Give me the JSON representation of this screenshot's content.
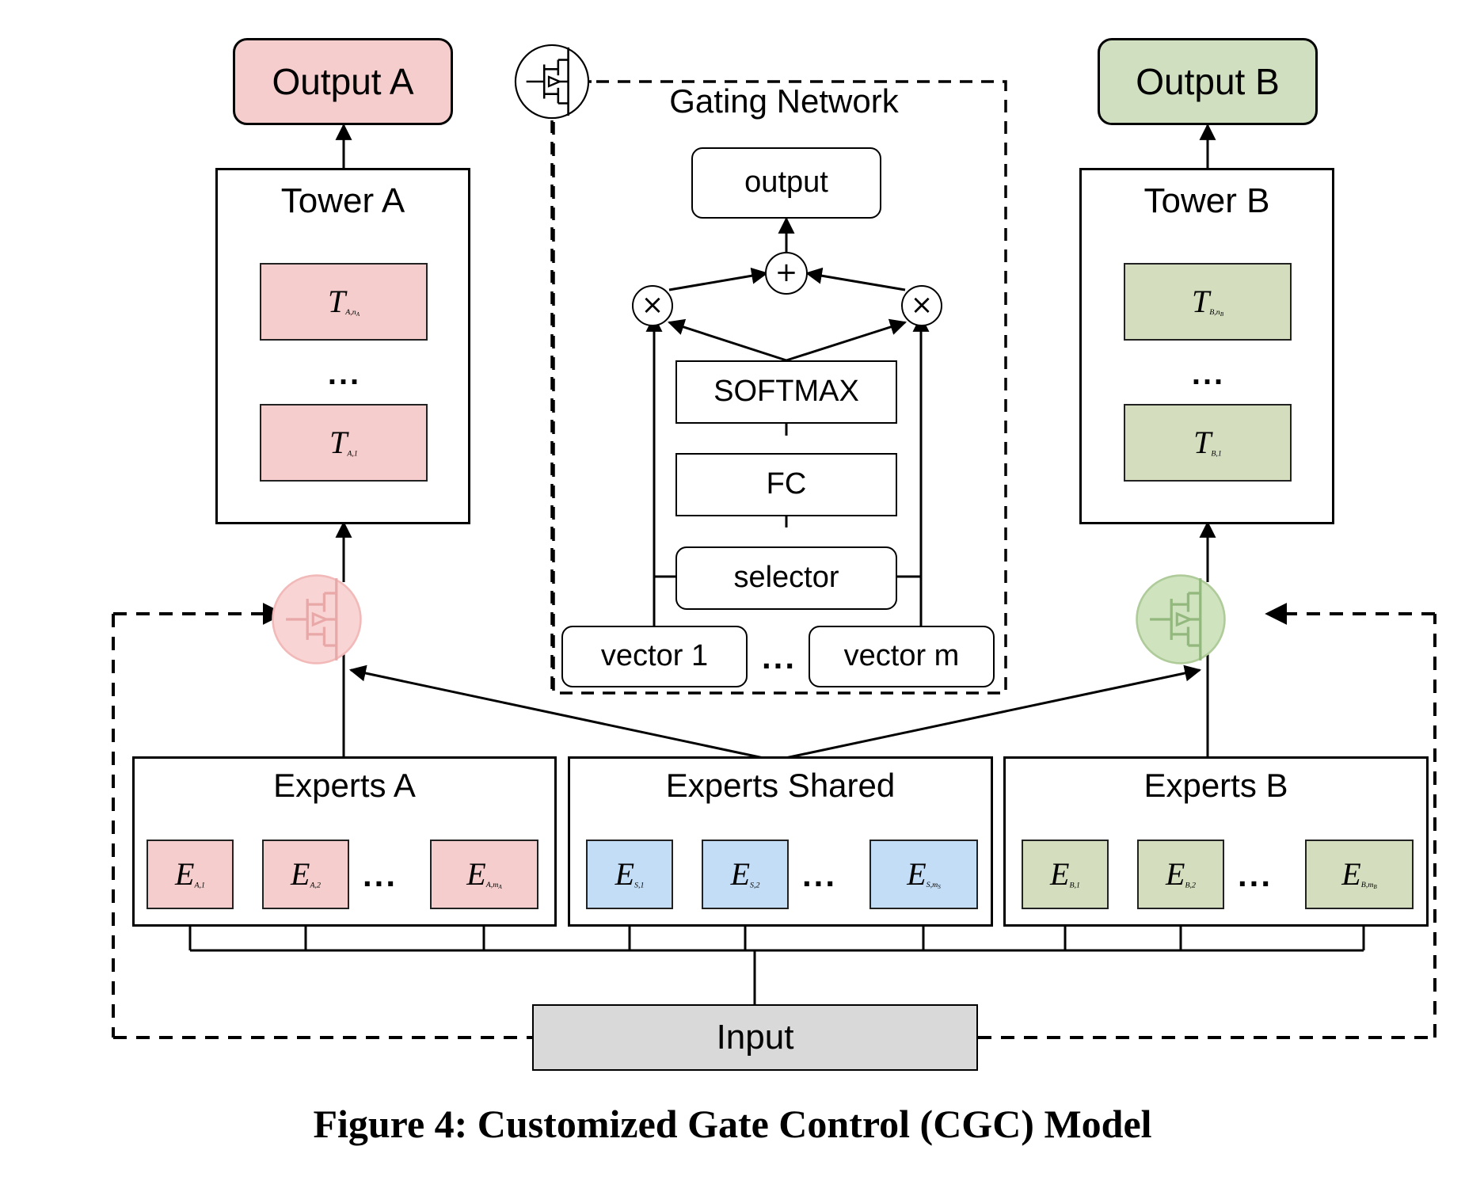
{
  "figure": {
    "caption": "Figure 4: Customized Gate Control (CGC) Model",
    "colors": {
      "task_a": "#f6cdcd",
      "task_b": "#d4debf",
      "shared": "#c3ddf6",
      "input": "#d9d9d9",
      "stroke": "#000000"
    }
  },
  "outputs": {
    "a": "Output A",
    "b": "Output B"
  },
  "towers": {
    "a": {
      "title": "Tower A",
      "top_block": {
        "base": "T",
        "sub": "A,n",
        "subsub": "A"
      },
      "bottom_block": {
        "base": "T",
        "sub": "A,1",
        "subsub": ""
      },
      "ellipsis": "..."
    },
    "b": {
      "title": "Tower B",
      "top_block": {
        "base": "T",
        "sub": "B,n",
        "subsub": "B"
      },
      "bottom_block": {
        "base": "T",
        "sub": "B,1",
        "subsub": ""
      },
      "ellipsis": "..."
    }
  },
  "gating_network": {
    "title": "Gating Network",
    "output_box": "output",
    "sum_op": "+",
    "mul_op_left": "×",
    "mul_op_right": "×",
    "softmax": "SOFTMAX",
    "fc": "FC",
    "selector": "selector",
    "vector_first": "vector 1",
    "vector_last": "vector m",
    "vector_ellipsis": "..."
  },
  "experts": {
    "a": {
      "title": "Experts A",
      "items": [
        {
          "base": "E",
          "sub": "A,1",
          "subsub": ""
        },
        {
          "base": "E",
          "sub": "A,2",
          "subsub": ""
        },
        {
          "base": "E",
          "sub": "A,m",
          "subsub": "A"
        }
      ],
      "ellipsis": "..."
    },
    "shared": {
      "title": "Experts Shared",
      "items": [
        {
          "base": "E",
          "sub": "S,1",
          "subsub": ""
        },
        {
          "base": "E",
          "sub": "S,2",
          "subsub": ""
        },
        {
          "base": "E",
          "sub": "S,m",
          "subsub": "S"
        }
      ],
      "ellipsis": "..."
    },
    "b": {
      "title": "Experts B",
      "items": [
        {
          "base": "E",
          "sub": "B,1",
          "subsub": ""
        },
        {
          "base": "E",
          "sub": "B,2",
          "subsub": ""
        },
        {
          "base": "E",
          "sub": "B,m",
          "subsub": "B"
        }
      ],
      "ellipsis": "..."
    }
  },
  "input": {
    "label": "Input"
  },
  "gates": {
    "top_icon": "gate-icon",
    "left_icon": "gate-icon",
    "right_icon": "gate-icon"
  }
}
